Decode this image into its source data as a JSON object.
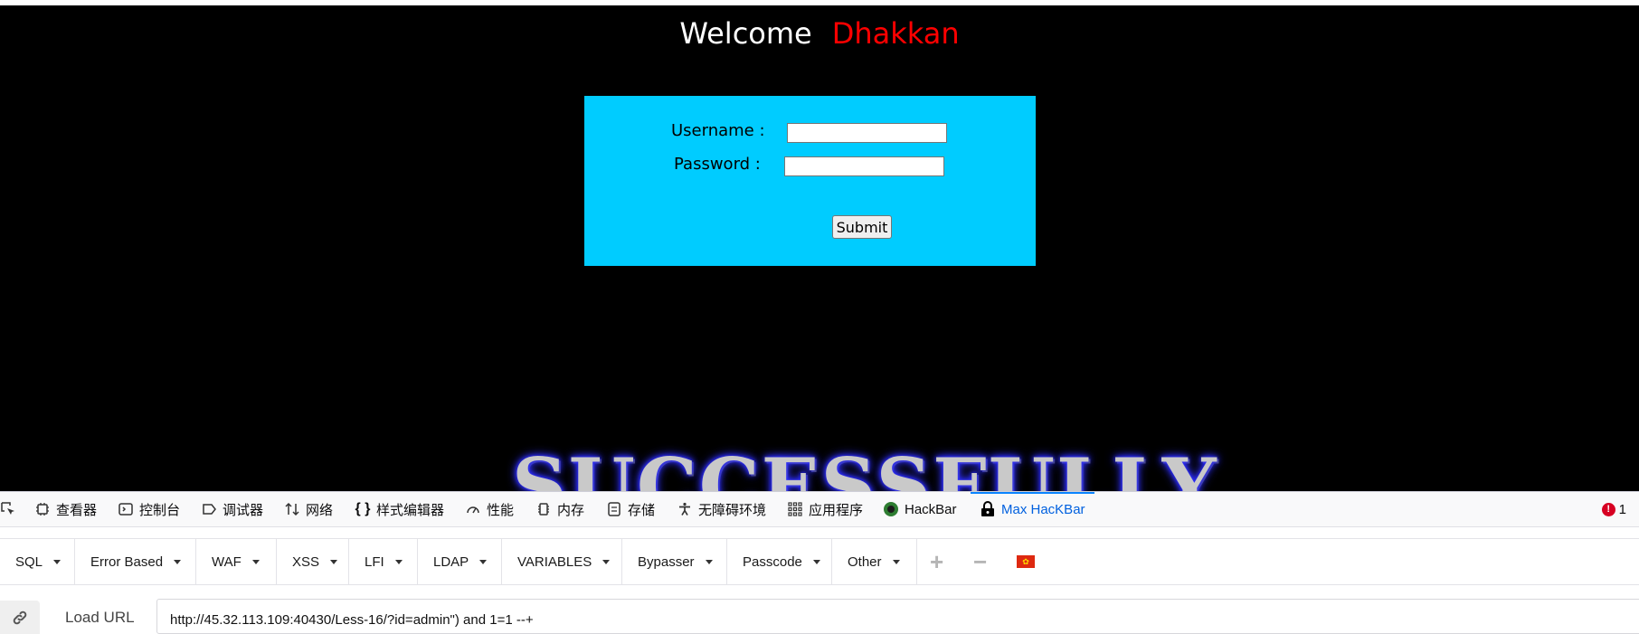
{
  "page": {
    "welcome_text": "Welcome",
    "user_name": "Dhakkan",
    "login": {
      "username_label": "Username :",
      "password_label": "Password :",
      "username_value": "",
      "password_value": "",
      "submit_label": "Submit"
    },
    "banner_text": "SUCCESSFULLY"
  },
  "devtools": {
    "tabs": [
      {
        "label": "查看器",
        "icon": "inspector-icon"
      },
      {
        "label": "控制台",
        "icon": "console-icon"
      },
      {
        "label": "调试器",
        "icon": "debugger-icon"
      },
      {
        "label": "网络",
        "icon": "network-icon"
      },
      {
        "label": "样式编辑器",
        "icon": "style-editor-icon"
      },
      {
        "label": "性能",
        "icon": "performance-icon"
      },
      {
        "label": "内存",
        "icon": "memory-icon"
      },
      {
        "label": "存储",
        "icon": "storage-icon"
      },
      {
        "label": "无障碍环境",
        "icon": "accessibility-icon"
      },
      {
        "label": "应用程序",
        "icon": "application-icon"
      },
      {
        "label": "HackBar",
        "icon": "hackbar-icon"
      },
      {
        "label": "Max HacKBar",
        "icon": "max-hackbar-icon"
      }
    ],
    "error_count": "1"
  },
  "hackbar": {
    "menus": [
      "SQL",
      "Error Based",
      "WAF",
      "XSS",
      "LFI",
      "LDAP",
      "VARIABLES",
      "Bypasser",
      "Passcode",
      "Other"
    ],
    "load_url_label": "Load URL",
    "url_value": "http://45.32.113.109:40430/Less-16/?id=admin\") and 1=1 --+"
  },
  "colors": {
    "page_bg": "#000000",
    "login_bg": "#00ccff",
    "user_name": "#ff0000",
    "active_tab": "#0060df"
  }
}
